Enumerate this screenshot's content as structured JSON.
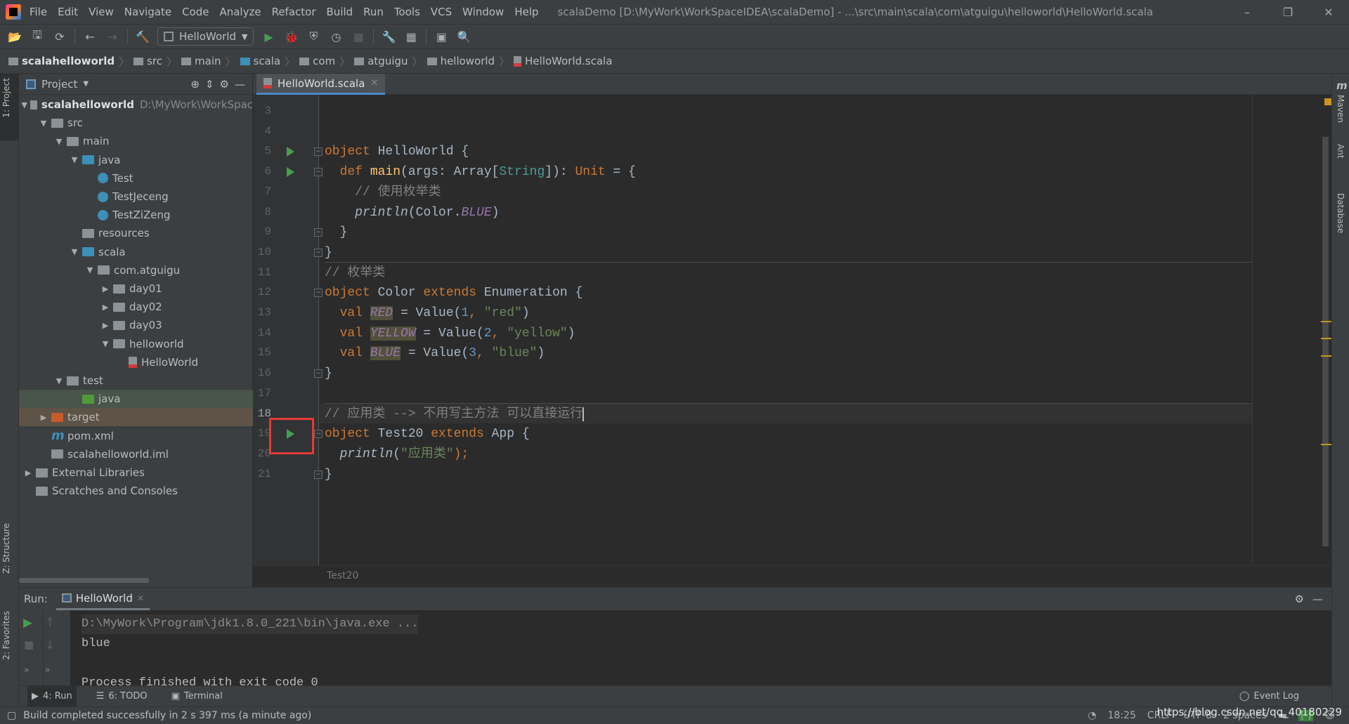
{
  "menubar": {
    "items": [
      "File",
      "Edit",
      "View",
      "Navigate",
      "Code",
      "Analyze",
      "Refactor",
      "Build",
      "Run",
      "Tools",
      "VCS",
      "Window",
      "Help"
    ],
    "title": "scalaDemo [D:\\MyWork\\WorkSpaceIDEA\\scalaDemo] - ...\\src\\main\\scala\\com\\atguigu\\helloworld\\HelloWorld.scala",
    "window_controls": [
      "–",
      "❐",
      "✕"
    ]
  },
  "toolbar": {
    "run_config": "HelloWorld"
  },
  "breadcrumb": [
    "scalahelloworld",
    "src",
    "main",
    "scala",
    "com",
    "atguigu",
    "helloworld",
    "HelloWorld.scala"
  ],
  "left_stripe": {
    "project_tab": "1: Project",
    "structure_tab": "Z: Structure",
    "favorites_tab": "2: Favorites"
  },
  "right_stripe": {
    "tabs": [
      "Maven",
      "Ant",
      "Database"
    ]
  },
  "project": {
    "header": "Project",
    "tree": [
      {
        "label": "scalahelloworld",
        "extra": "D:\\MyWork\\WorkSpac",
        "depth": 0,
        "arrow": "down",
        "icon": "module",
        "bold": true
      },
      {
        "label": "src",
        "depth": 1,
        "arrow": "down",
        "icon": "folder"
      },
      {
        "label": "main",
        "depth": 2,
        "arrow": "down",
        "icon": "folder"
      },
      {
        "label": "java",
        "depth": 3,
        "arrow": "down",
        "icon": "source-folder"
      },
      {
        "label": "Test",
        "depth": 4,
        "arrow": "",
        "icon": "java-class"
      },
      {
        "label": "TestJeceng",
        "depth": 4,
        "arrow": "",
        "icon": "java-class"
      },
      {
        "label": "TestZiZeng",
        "depth": 4,
        "arrow": "",
        "icon": "java-class"
      },
      {
        "label": "resources",
        "depth": 3,
        "arrow": "",
        "icon": "resources-folder"
      },
      {
        "label": "scala",
        "depth": 3,
        "arrow": "down",
        "icon": "source-folder"
      },
      {
        "label": "com.atguigu",
        "depth": 4,
        "arrow": "down",
        "icon": "package"
      },
      {
        "label": "day01",
        "depth": 5,
        "arrow": "right",
        "icon": "package"
      },
      {
        "label": "day02",
        "depth": 5,
        "arrow": "right",
        "icon": "package"
      },
      {
        "label": "day03",
        "depth": 5,
        "arrow": "right",
        "icon": "package"
      },
      {
        "label": "helloworld",
        "depth": 5,
        "arrow": "down",
        "icon": "package"
      },
      {
        "label": "HelloWorld",
        "depth": 6,
        "arrow": "",
        "icon": "scala-file"
      },
      {
        "label": "test",
        "depth": 2,
        "arrow": "down",
        "icon": "folder"
      },
      {
        "label": "java",
        "depth": 3,
        "arrow": "",
        "icon": "test-folder",
        "row": "test"
      },
      {
        "label": "target",
        "depth": 1,
        "arrow": "right",
        "icon": "excluded-folder",
        "row": "excluded"
      },
      {
        "label": "pom.xml",
        "depth": 1,
        "arrow": "",
        "icon": "maven"
      },
      {
        "label": "scalahelloworld.iml",
        "depth": 1,
        "arrow": "",
        "icon": "iml-file"
      },
      {
        "label": "External Libraries",
        "depth": 0,
        "arrow": "right",
        "icon": "libraries"
      },
      {
        "label": "Scratches and Consoles",
        "depth": 0,
        "arrow": "",
        "icon": "scratches"
      }
    ]
  },
  "editor": {
    "tab": "HelloWorld.scala",
    "current_line": 18,
    "run_gutter_lines": [
      5,
      6,
      19
    ],
    "lines": [
      {
        "n": 3,
        "t": []
      },
      {
        "n": 4,
        "t": []
      },
      {
        "n": 5,
        "t": [
          [
            "object ",
            "kw"
          ],
          [
            "HelloWorld {",
            ""
          ]
        ]
      },
      {
        "n": 6,
        "t": [
          [
            "  def ",
            "kw"
          ],
          [
            "main",
            "fn"
          ],
          [
            "(args: Array[",
            ""
          ],
          [
            "String",
            "tp"
          ],
          [
            "]): ",
            ""
          ],
          [
            "Unit",
            "kw"
          ],
          [
            " = {",
            ""
          ]
        ]
      },
      {
        "n": 7,
        "t": [
          [
            "    // 使用枚举类",
            "com"
          ]
        ]
      },
      {
        "n": 8,
        "t": [
          [
            "    ",
            ""
          ],
          [
            "println",
            "it"
          ],
          [
            "(Color.",
            ""
          ],
          [
            "BLUE",
            "const"
          ],
          [
            ")",
            ""
          ]
        ]
      },
      {
        "n": 9,
        "t": [
          [
            "  }",
            ""
          ]
        ]
      },
      {
        "n": 10,
        "t": [
          [
            "}",
            ""
          ]
        ]
      },
      {
        "n": 11,
        "t": [
          [
            "// 枚举类",
            "com"
          ]
        ]
      },
      {
        "n": 12,
        "t": [
          [
            "object ",
            "kw"
          ],
          [
            "Color ",
            ""
          ],
          [
            "extends ",
            "kw"
          ],
          [
            "Enumeration {",
            ""
          ]
        ]
      },
      {
        "n": 13,
        "t": [
          [
            "  val ",
            "kw"
          ],
          [
            "RED",
            "const hl"
          ],
          [
            " = Value(",
            ""
          ],
          [
            "1",
            "num"
          ],
          [
            ", ",
            "kw"
          ],
          [
            "\"red\"",
            "str"
          ],
          [
            ")",
            ""
          ]
        ]
      },
      {
        "n": 14,
        "t": [
          [
            "  val ",
            "kw"
          ],
          [
            "YELLOW",
            "const hl"
          ],
          [
            " = Value(",
            ""
          ],
          [
            "2",
            "num"
          ],
          [
            ", ",
            "kw"
          ],
          [
            "\"yellow\"",
            "str"
          ],
          [
            ")",
            ""
          ]
        ]
      },
      {
        "n": 15,
        "t": [
          [
            "  val ",
            "kw"
          ],
          [
            "BLUE",
            "const hl"
          ],
          [
            " = Value(",
            ""
          ],
          [
            "3",
            "num"
          ],
          [
            ", ",
            "kw"
          ],
          [
            "\"blue\"",
            "str"
          ],
          [
            ")",
            ""
          ]
        ]
      },
      {
        "n": 16,
        "t": [
          [
            "}",
            ""
          ]
        ]
      },
      {
        "n": 17,
        "t": []
      },
      {
        "n": 18,
        "t": [
          [
            "// 应用类 --> 不用写主方法 可以直接运行",
            "com"
          ]
        ]
      },
      {
        "n": 19,
        "t": [
          [
            "object ",
            "kw"
          ],
          [
            "Test20 ",
            ""
          ],
          [
            "extends ",
            "kw"
          ],
          [
            "App {",
            ""
          ]
        ]
      },
      {
        "n": 20,
        "t": [
          [
            "  ",
            ""
          ],
          [
            "println",
            "it"
          ],
          [
            "(",
            ""
          ],
          [
            "\"应用类\"",
            "str"
          ],
          [
            ");",
            "kw"
          ]
        ]
      },
      {
        "n": 21,
        "t": [
          [
            "}",
            ""
          ]
        ]
      }
    ],
    "breadcrumb": "Test20"
  },
  "run_panel": {
    "label": "Run:",
    "tab": "HelloWorld",
    "output": [
      "D:\\MyWork\\Program\\jdk1.8.0_221\\bin\\java.exe ...",
      "blue",
      "",
      "Process finished with exit code 0"
    ]
  },
  "bottom_tabs": [
    "4: Run",
    "6: TODO",
    "Terminal"
  ],
  "event_log": "Event Log",
  "status": {
    "message": "Build completed successfully in 2 s 397 ms (a minute ago)",
    "position": "18:25",
    "line_sep": "CRLF",
    "encoding": "UTF-8",
    "indent": "2 spaces",
    "watermark": "https://blog.csdn.net/qq_40180229"
  },
  "colors": {
    "accent": "#4a88c7",
    "run_green": "#499c54",
    "highlight_box": "#e53935",
    "keyword": "#cc7832",
    "string": "#6a8759",
    "constant": "#9876aa"
  }
}
